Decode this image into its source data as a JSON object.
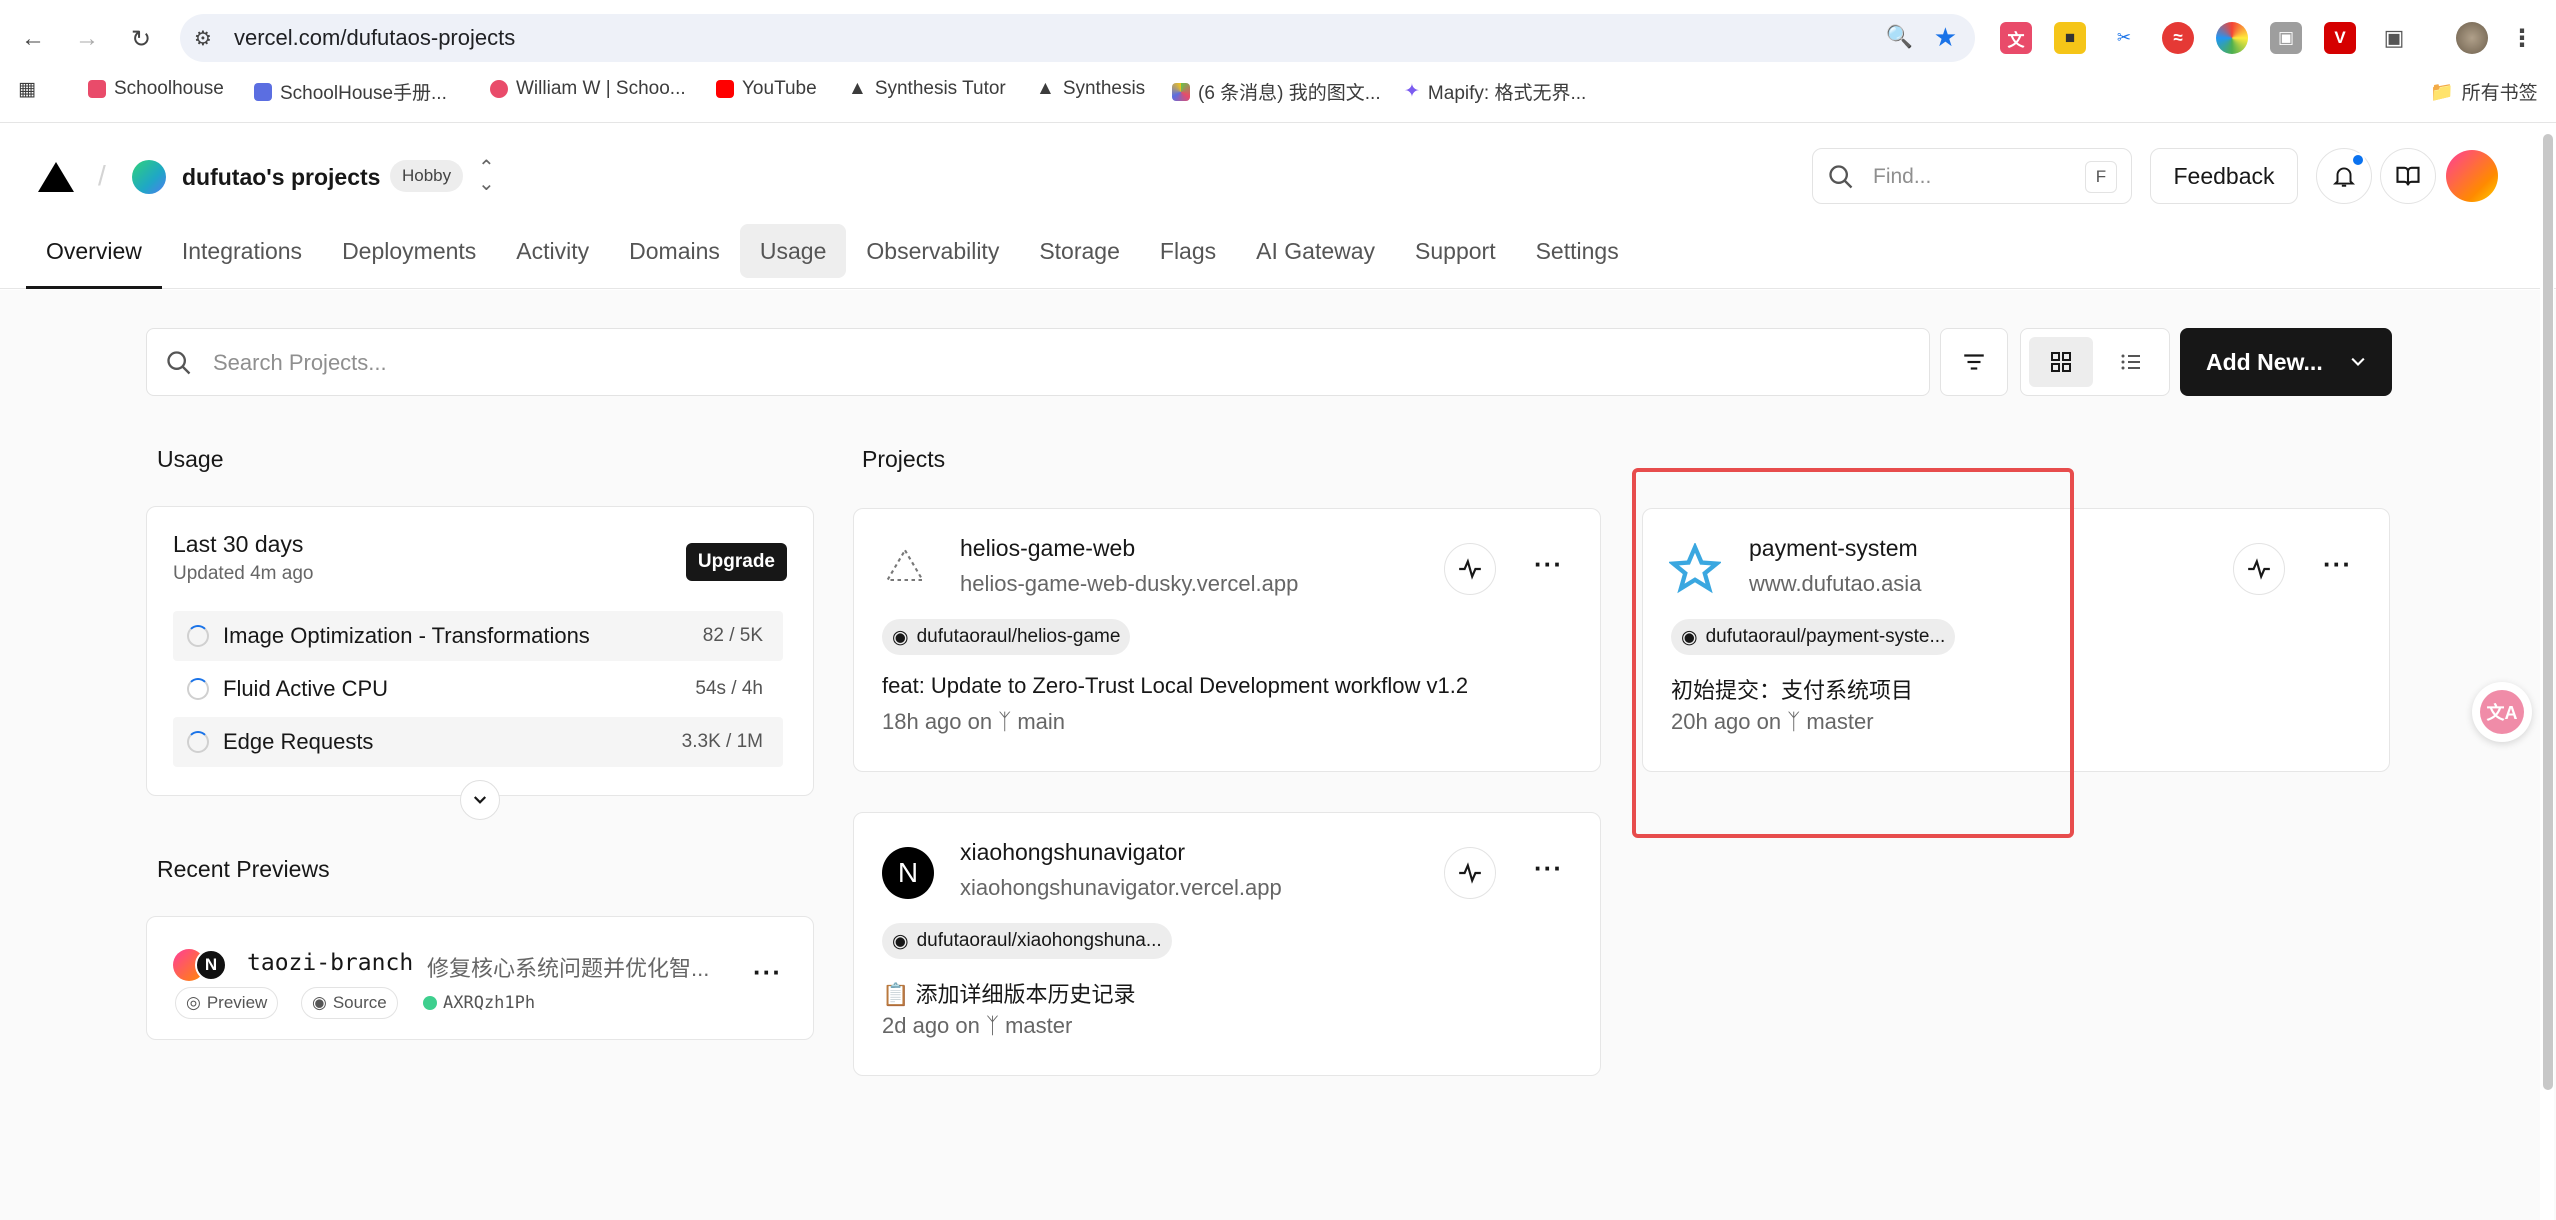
{
  "browser": {
    "url": "vercel.com/dufutaos-projects",
    "bookmarks": [
      {
        "label": "Schoolhouse",
        "color": "#e94b6a"
      },
      {
        "label": "SchoolHouse手册...",
        "color": "#5b6ee1"
      },
      {
        "label": "William W | Schoo...",
        "color": "#e94b6a"
      },
      {
        "label": "YouTube",
        "color": "#ff0000"
      },
      {
        "label": "Synthesis Tutor",
        "color": "#222222"
      },
      {
        "label": "Synthesis",
        "color": "#222222"
      },
      {
        "label": "(6 条消息) 我的图文...",
        "color": "#6bc04b"
      },
      {
        "label": "Mapify: 格式无界...",
        "color": "#7b5cf0"
      }
    ],
    "all_bookmarks": "所有书签"
  },
  "header": {
    "project_owner": "dufutao's projects",
    "plan_badge": "Hobby",
    "find_placeholder": "Find...",
    "find_shortcut": "F",
    "feedback_label": "Feedback",
    "tabs": [
      "Overview",
      "Integrations",
      "Deployments",
      "Activity",
      "Domains",
      "Usage",
      "Observability",
      "Storage",
      "Flags",
      "AI Gateway",
      "Support",
      "Settings"
    ],
    "active_tab": "Overview",
    "hovered_tab": "Usage"
  },
  "toolbar": {
    "search_placeholder": "Search Projects...",
    "add_new_label": "Add New..."
  },
  "usage": {
    "section_title": "Usage",
    "period": "Last 30 days",
    "updated": "Updated 4m ago",
    "upgrade_label": "Upgrade",
    "rows": [
      {
        "name": "Image Optimization - Transformations",
        "value": "82 / 5K"
      },
      {
        "name": "Fluid Active CPU",
        "value": "54s / 4h"
      },
      {
        "name": "Edge Requests",
        "value": "3.3K / 1M"
      }
    ]
  },
  "recent_previews": {
    "section_title": "Recent Previews",
    "branch": "taozi-branch",
    "message": "修复核心系统问题并优化智...",
    "avatar_letter": "N",
    "preview_label": "Preview",
    "source_label": "Source",
    "commit_id": "AXRQzh1Ph"
  },
  "projects": {
    "section_title": "Projects",
    "items": [
      {
        "name": "helios-game-web",
        "url": "helios-game-web-dusky.vercel.app",
        "repo": "dufutaoraul/helios-game",
        "commit": "feat: Update to Zero-Trust Local Development workflow v1.2",
        "ago": "18h ago on",
        "branch": "main"
      },
      {
        "name": "xiaohongshunavigator",
        "url": "xiaohongshunavigator.vercel.app",
        "repo": "dufutaoraul/xiaohongshuna...",
        "commit": "📋 添加详细版本历史记录",
        "ago": "2d ago on",
        "branch": "master"
      },
      {
        "name": "payment-system",
        "url": "www.dufutao.asia",
        "repo": "dufutaoraul/payment-syste...",
        "commit": "初始提交：支付系统项目",
        "ago": "20h ago on",
        "branch": "master"
      }
    ]
  },
  "floating_widget": "文A",
  "colors": {
    "accent": "#0a72ef",
    "highlight": "#e74c4c",
    "dark": "#171717"
  }
}
